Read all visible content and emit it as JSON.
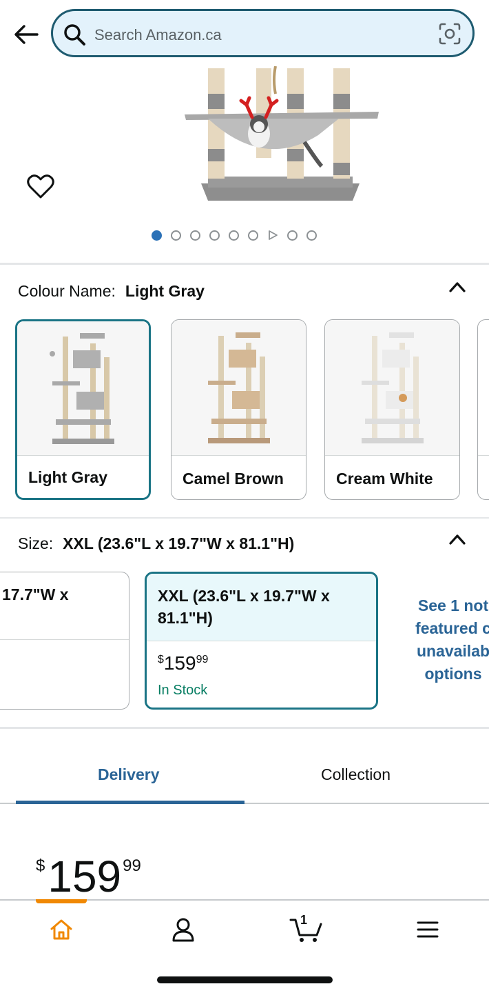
{
  "header": {
    "search_placeholder": "Search Amazon.ca"
  },
  "gallery": {
    "image_count": 9,
    "active_index": 0,
    "video_index": 6
  },
  "colour": {
    "label": "Colour Name:",
    "selected": "Light Gray",
    "options": [
      {
        "label": "Light Gray",
        "selected": true
      },
      {
        "label": "Camel Brown",
        "selected": false
      },
      {
        "label": "Cream White",
        "selected": false
      }
    ]
  },
  "size": {
    "label": "Size:",
    "selected": "XXL (23.6\"L x 19.7\"W x 81.1\"H)",
    "options": [
      {
        "label_line1": "17.7\"W x",
        "label_line2": "",
        "selected": false
      },
      {
        "label_line1": "XXL (23.6\"L x 19.7\"W x",
        "label_line2": "81.1\"H)",
        "price_dollars": "159",
        "price_cents": "99",
        "price_currency": "$",
        "stock": "In Stock",
        "selected": true
      }
    ],
    "see_more_lines": [
      "See 1 not",
      "featured c",
      "unavailab",
      "options"
    ]
  },
  "tabs": {
    "delivery": "Delivery",
    "collection": "Collection",
    "active": "Delivery"
  },
  "price": {
    "currency": "$",
    "dollars": "159",
    "cents": "99"
  },
  "bottom_nav": {
    "active": "home",
    "cart_count": "1",
    "items": [
      "home-icon",
      "account-icon",
      "cart-icon",
      "menu-icon"
    ]
  },
  "colors": {
    "accent_teal": "#1a7485",
    "link_blue": "#2a6496",
    "in_stock_green": "#067d62",
    "nav_active_orange": "#f08804",
    "search_bg": "#e3f2fb"
  }
}
